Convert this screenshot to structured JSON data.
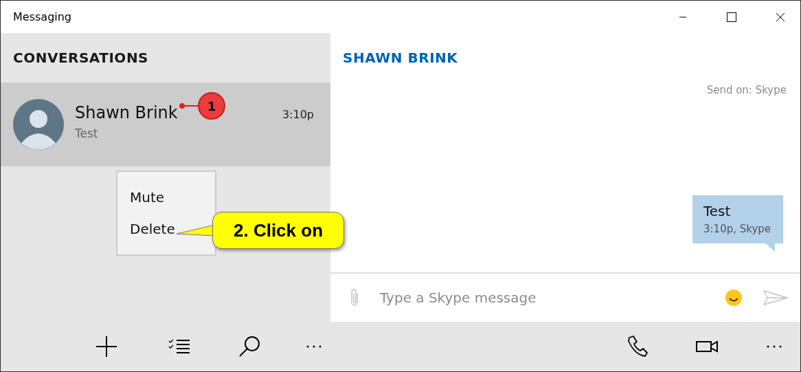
{
  "window": {
    "title": "Messaging"
  },
  "conversations": {
    "heading": "CONVERSATIONS",
    "items": [
      {
        "name": "Shawn Brink",
        "preview": "Test",
        "time": "3:10p",
        "selected": true
      }
    ]
  },
  "context_menu": {
    "items": [
      "Mute",
      "Delete"
    ]
  },
  "chat": {
    "contact": "SHAWN BRINK",
    "send_on": "Send on: Skype",
    "messages": [
      {
        "text": "Test",
        "meta": "3:10p, Skype"
      }
    ],
    "composer": {
      "placeholder": "Type a Skype message"
    }
  },
  "annotations": [
    {
      "kind": "badge",
      "text": "1"
    },
    {
      "kind": "callout",
      "text": "2. Click on"
    }
  ]
}
